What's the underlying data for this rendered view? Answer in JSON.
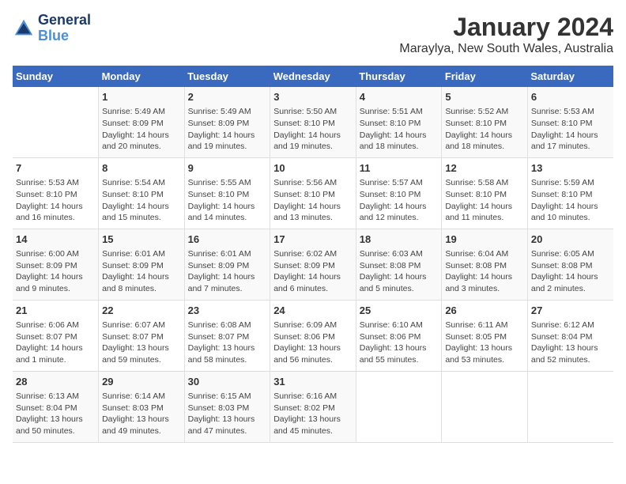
{
  "app": {
    "logo_line1": "General",
    "logo_line2": "Blue",
    "title": "January 2024",
    "subtitle": "Maraylya, New South Wales, Australia"
  },
  "calendar": {
    "headers": [
      "Sunday",
      "Monday",
      "Tuesday",
      "Wednesday",
      "Thursday",
      "Friday",
      "Saturday"
    ],
    "rows": [
      [
        {
          "num": "",
          "info": ""
        },
        {
          "num": "1",
          "info": "Sunrise: 5:49 AM\nSunset: 8:09 PM\nDaylight: 14 hours\nand 20 minutes."
        },
        {
          "num": "2",
          "info": "Sunrise: 5:49 AM\nSunset: 8:09 PM\nDaylight: 14 hours\nand 19 minutes."
        },
        {
          "num": "3",
          "info": "Sunrise: 5:50 AM\nSunset: 8:10 PM\nDaylight: 14 hours\nand 19 minutes."
        },
        {
          "num": "4",
          "info": "Sunrise: 5:51 AM\nSunset: 8:10 PM\nDaylight: 14 hours\nand 18 minutes."
        },
        {
          "num": "5",
          "info": "Sunrise: 5:52 AM\nSunset: 8:10 PM\nDaylight: 14 hours\nand 18 minutes."
        },
        {
          "num": "6",
          "info": "Sunrise: 5:53 AM\nSunset: 8:10 PM\nDaylight: 14 hours\nand 17 minutes."
        }
      ],
      [
        {
          "num": "7",
          "info": "Sunrise: 5:53 AM\nSunset: 8:10 PM\nDaylight: 14 hours\nand 16 minutes."
        },
        {
          "num": "8",
          "info": "Sunrise: 5:54 AM\nSunset: 8:10 PM\nDaylight: 14 hours\nand 15 minutes."
        },
        {
          "num": "9",
          "info": "Sunrise: 5:55 AM\nSunset: 8:10 PM\nDaylight: 14 hours\nand 14 minutes."
        },
        {
          "num": "10",
          "info": "Sunrise: 5:56 AM\nSunset: 8:10 PM\nDaylight: 14 hours\nand 13 minutes."
        },
        {
          "num": "11",
          "info": "Sunrise: 5:57 AM\nSunset: 8:10 PM\nDaylight: 14 hours\nand 12 minutes."
        },
        {
          "num": "12",
          "info": "Sunrise: 5:58 AM\nSunset: 8:10 PM\nDaylight: 14 hours\nand 11 minutes."
        },
        {
          "num": "13",
          "info": "Sunrise: 5:59 AM\nSunset: 8:10 PM\nDaylight: 14 hours\nand 10 minutes."
        }
      ],
      [
        {
          "num": "14",
          "info": "Sunrise: 6:00 AM\nSunset: 8:09 PM\nDaylight: 14 hours\nand 9 minutes."
        },
        {
          "num": "15",
          "info": "Sunrise: 6:01 AM\nSunset: 8:09 PM\nDaylight: 14 hours\nand 8 minutes."
        },
        {
          "num": "16",
          "info": "Sunrise: 6:01 AM\nSunset: 8:09 PM\nDaylight: 14 hours\nand 7 minutes."
        },
        {
          "num": "17",
          "info": "Sunrise: 6:02 AM\nSunset: 8:09 PM\nDaylight: 14 hours\nand 6 minutes."
        },
        {
          "num": "18",
          "info": "Sunrise: 6:03 AM\nSunset: 8:08 PM\nDaylight: 14 hours\nand 5 minutes."
        },
        {
          "num": "19",
          "info": "Sunrise: 6:04 AM\nSunset: 8:08 PM\nDaylight: 14 hours\nand 3 minutes."
        },
        {
          "num": "20",
          "info": "Sunrise: 6:05 AM\nSunset: 8:08 PM\nDaylight: 14 hours\nand 2 minutes."
        }
      ],
      [
        {
          "num": "21",
          "info": "Sunrise: 6:06 AM\nSunset: 8:07 PM\nDaylight: 14 hours\nand 1 minute."
        },
        {
          "num": "22",
          "info": "Sunrise: 6:07 AM\nSunset: 8:07 PM\nDaylight: 13 hours\nand 59 minutes."
        },
        {
          "num": "23",
          "info": "Sunrise: 6:08 AM\nSunset: 8:07 PM\nDaylight: 13 hours\nand 58 minutes."
        },
        {
          "num": "24",
          "info": "Sunrise: 6:09 AM\nSunset: 8:06 PM\nDaylight: 13 hours\nand 56 minutes."
        },
        {
          "num": "25",
          "info": "Sunrise: 6:10 AM\nSunset: 8:06 PM\nDaylight: 13 hours\nand 55 minutes."
        },
        {
          "num": "26",
          "info": "Sunrise: 6:11 AM\nSunset: 8:05 PM\nDaylight: 13 hours\nand 53 minutes."
        },
        {
          "num": "27",
          "info": "Sunrise: 6:12 AM\nSunset: 8:04 PM\nDaylight: 13 hours\nand 52 minutes."
        }
      ],
      [
        {
          "num": "28",
          "info": "Sunrise: 6:13 AM\nSunset: 8:04 PM\nDaylight: 13 hours\nand 50 minutes."
        },
        {
          "num": "29",
          "info": "Sunrise: 6:14 AM\nSunset: 8:03 PM\nDaylight: 13 hours\nand 49 minutes."
        },
        {
          "num": "30",
          "info": "Sunrise: 6:15 AM\nSunset: 8:03 PM\nDaylight: 13 hours\nand 47 minutes."
        },
        {
          "num": "31",
          "info": "Sunrise: 6:16 AM\nSunset: 8:02 PM\nDaylight: 13 hours\nand 45 minutes."
        },
        {
          "num": "",
          "info": ""
        },
        {
          "num": "",
          "info": ""
        },
        {
          "num": "",
          "info": ""
        }
      ]
    ]
  }
}
